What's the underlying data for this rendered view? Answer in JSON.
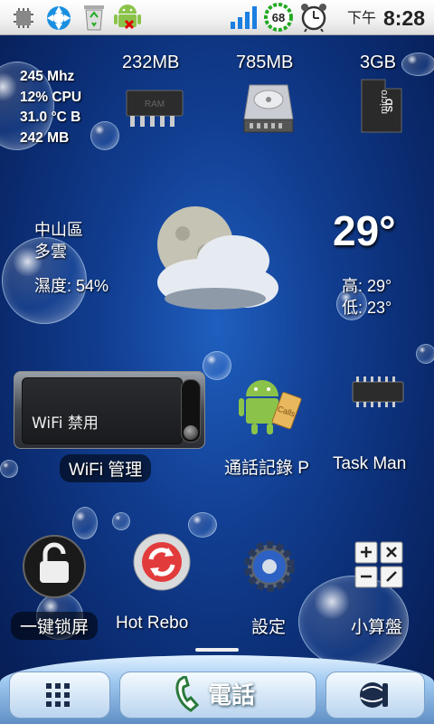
{
  "status_bar": {
    "icons": [
      "sdcard-icon",
      "browser-icon",
      "recycle-bin-icon",
      "android-remove-icon",
      "signal-bars-icon",
      "battery-circle-icon",
      "alarm-clock-icon"
    ],
    "battery_level": "68",
    "signal_level": 1.0,
    "ampm": "下午",
    "time": "8:28"
  },
  "system_stats": {
    "cpu_freq": "245 Mhz",
    "cpu_usage": "12% CPU",
    "temperature": "31.0 °C B",
    "memory": "242 MB"
  },
  "storage": [
    {
      "label": "232MB",
      "icon": "ram-chip-icon"
    },
    {
      "label": "785MB",
      "icon": "hard-drive-icon"
    },
    {
      "label": "3GB",
      "icon": "microsd-card-icon"
    }
  ],
  "weather": {
    "district": "中山區",
    "condition": "多雲",
    "humidity": "濕度: 54%",
    "temperature": "29°",
    "high": "高: 29°",
    "low": "低: 23°"
  },
  "wifi_widget": {
    "status": "WiFi 禁用",
    "label": "WiFi 管理"
  },
  "apps_row1": [
    {
      "label": "通話記錄 P",
      "icon": "call-log-android-icon"
    },
    {
      "label": "Task Man",
      "icon": "task-manager-chip-icon"
    }
  ],
  "apps_row2": [
    {
      "label": "一键锁屏",
      "icon": "padlock-icon"
    },
    {
      "label": "Hot Rebo",
      "icon": "reboot-icon"
    },
    {
      "label": "設定",
      "icon": "settings-gear-icon"
    },
    {
      "label": "小算盤",
      "icon": "calculator-icon"
    }
  ],
  "dock": {
    "phone_label": "電話",
    "left_icon": "app-drawer-grid-icon",
    "right_icon": "browser-globe-icon"
  },
  "colors": {
    "background": "#123f93",
    "status_bar": "#f1f1f1",
    "dock": "#9ec7ef"
  }
}
